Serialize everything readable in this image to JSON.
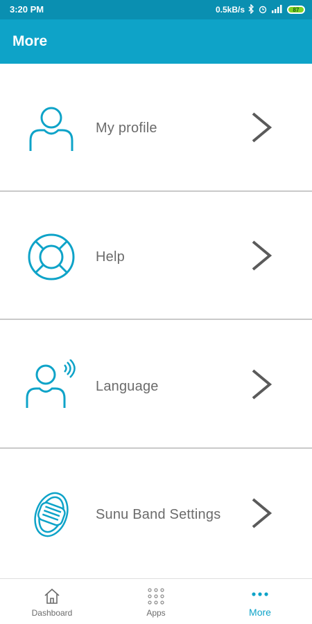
{
  "status_bar": {
    "time": "3:20 PM",
    "network_speed": "0.5kB/s",
    "battery_level": "87"
  },
  "app_bar": {
    "title": "More"
  },
  "menu": {
    "items": [
      {
        "label": "My profile",
        "icon": "person-icon"
      },
      {
        "label": "Help",
        "icon": "lifebuoy-icon"
      },
      {
        "label": "Language",
        "icon": "person-voice-icon"
      },
      {
        "label": "Sunu Band Settings",
        "icon": "wristband-icon"
      }
    ]
  },
  "bottom_nav": {
    "items": [
      {
        "label": "Dashboard",
        "icon": "home-icon"
      },
      {
        "label": "Apps",
        "icon": "grid-icon"
      },
      {
        "label": "More",
        "icon": "dots-icon"
      }
    ],
    "active": "More"
  },
  "colors": {
    "primary": "#0ea3c8",
    "status_bar": "#0a8fb1",
    "text": "#6b6b6b",
    "divider": "#c9c9c9"
  }
}
